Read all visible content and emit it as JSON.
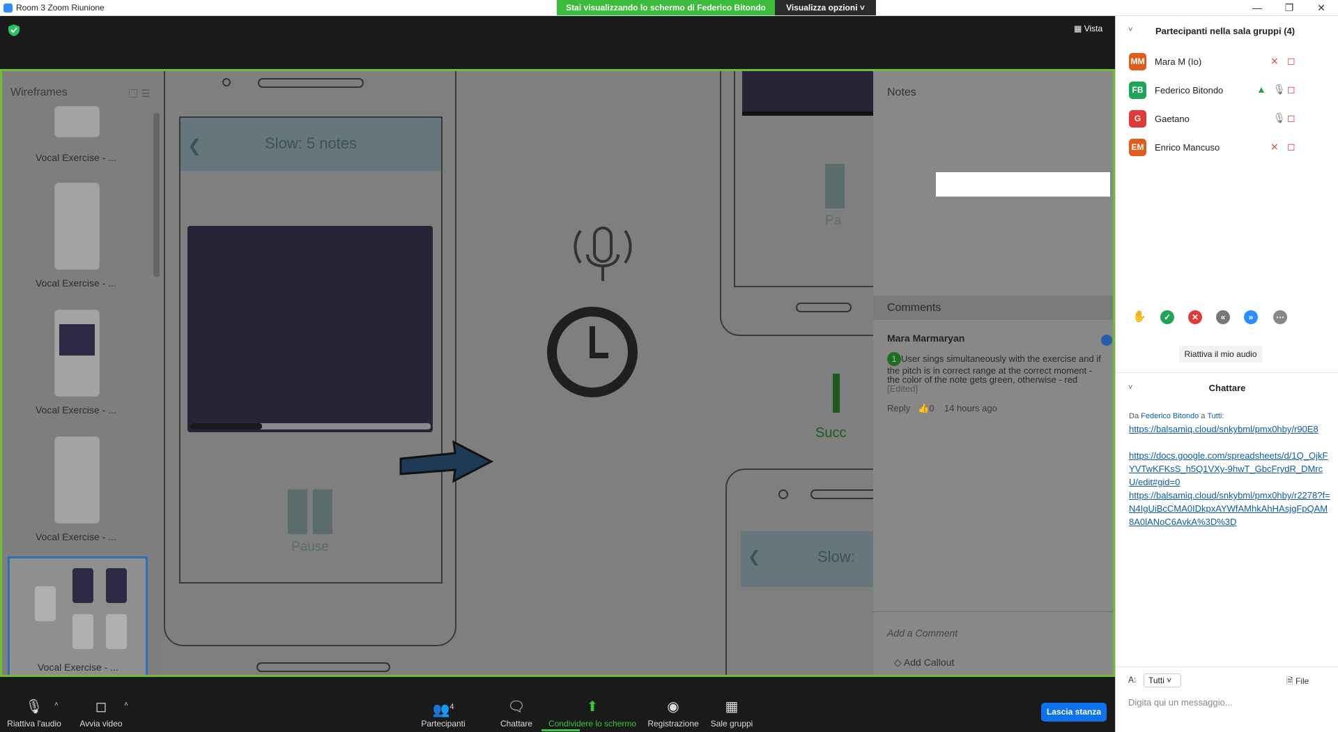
{
  "window": {
    "title": "Room 3  Zoom Riunione"
  },
  "share_banner": {
    "text": "Stai visualizzando lo schermo di Federico Bitondo",
    "view_options": "Visualizza opzioni"
  },
  "view": {
    "label": "Vista"
  },
  "shared": {
    "left_panel": {
      "header": "Wireframes",
      "thumbnails": [
        "Vocal Exercise - ...",
        "Vocal Exercise - ...",
        "Vocal Exercise - ...",
        "Vocal Exercise - ...",
        "Vocal Exercise - ..."
      ]
    },
    "canvas": {
      "screen_title": "Slow: 5 notes",
      "pause_label": "Pause",
      "partial_label_pa": "Pa",
      "partial_label_succ": "Succ",
      "partial_title_2": "Slow:"
    },
    "right_panel": {
      "notes_header": "Notes",
      "comments_header": "Comments",
      "comment": {
        "author": "Mara Marmaryan",
        "number": "1",
        "text": "User sings simultaneously with the exercise and if the pitch is in correct range at the correct moment - the color of the note gets green, otherwise - red",
        "edited": "[Edited]",
        "reply": "Reply",
        "likes": "0",
        "time": "14 hours ago"
      },
      "add_comment": "Add a Comment",
      "add_callout": "Add Callout"
    }
  },
  "toolbar": {
    "unmute": "Riattiva l'audio",
    "start_video": "Avvia video",
    "participants": "Partecipanti",
    "participants_count": "4",
    "chat": "Chattare",
    "share_screen": "Condividere lo schermo",
    "record": "Registrazione",
    "breakout": "Sale gruppi",
    "leave": "Lascia stanza"
  },
  "participants_panel": {
    "title": "Partecipanti nella sala gruppi (4)",
    "participants": [
      {
        "initials": "MM",
        "name": "Mara M (Io)",
        "color": "#e05e1c"
      },
      {
        "initials": "FB",
        "name": "Federico Bitondo",
        "color": "#22a35a"
      },
      {
        "initials": "G",
        "name": "Gaetano",
        "color": "#e03a3a"
      },
      {
        "initials": "EM",
        "name": "Enrico Mancuso",
        "color": "#e05e1c"
      }
    ],
    "unmute_me": "Riattiva il mio audio"
  },
  "chat_panel": {
    "title": "Chattare",
    "from_prefix": "Da",
    "from_sender": "Federico Bitondo",
    "from_middle": "a",
    "from_target": "Tutti:",
    "links": [
      "https://balsamiq.cloud/snkybml/pmx0hby/r90E8",
      "https://docs.google.com/spreadsheets/d/1Q_OjkFYVTwKFKsS_h5Q1VXy-9hwT_GbcFrydR_DMrcU/edit#gid=0",
      "https://balsamiq.cloud/snkybml/pmx0hby/r2278?f=N4IgUiBcCMA0IDkpxAYWfAMhkAhHAsjgFpQAM8A0lANoC6AvkA%3D%3D"
    ],
    "to_label": "A:",
    "to_value": "Tutti",
    "file": "File",
    "input_placeholder": "Digita qui un messaggio..."
  }
}
